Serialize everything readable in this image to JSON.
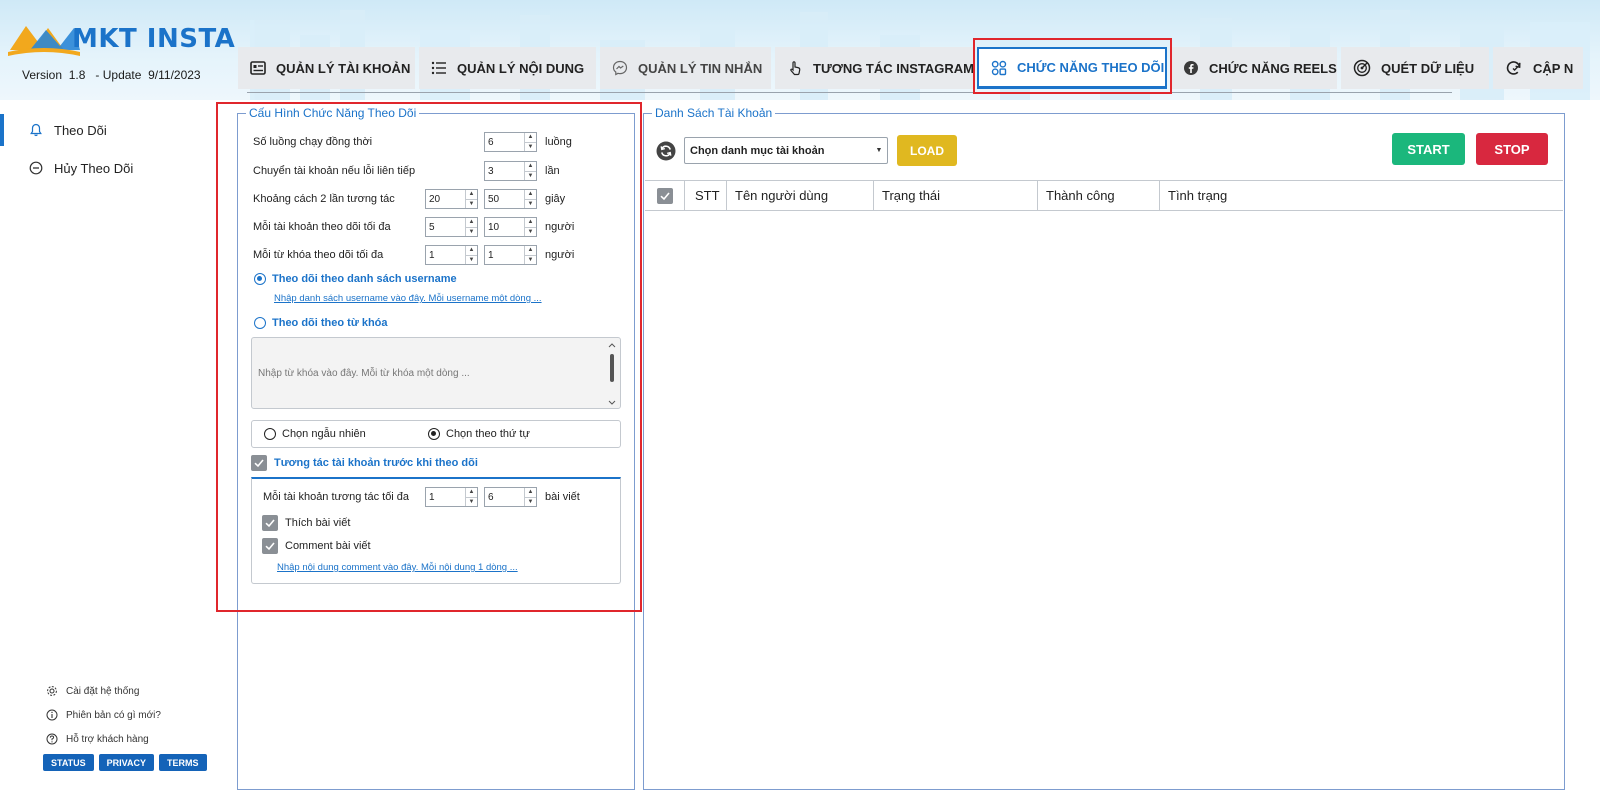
{
  "app": {
    "name": "MKT INSTA",
    "version_label": "Version",
    "version": "1.8",
    "update_label": "- Update",
    "update_date": "9/11/2023"
  },
  "tabs": [
    {
      "label": "QUẢN LÝ TÀI KHOẢN",
      "icon": "account-list-icon"
    },
    {
      "label": "QUẢN LÝ NỘI DUNG",
      "icon": "content-list-icon"
    },
    {
      "label": "QUẢN LÝ TIN NHẮN",
      "icon": "messenger-icon"
    },
    {
      "label": "TƯƠNG TÁC INSTAGRAM",
      "icon": "hand-tap-icon"
    },
    {
      "label": "CHỨC NĂNG THEO DÕI",
      "icon": "follow-grid-icon",
      "active": true
    },
    {
      "label": "CHỨC NĂNG REELS",
      "icon": "facebook-icon"
    },
    {
      "label": "QUÉT DỮ LIỆU",
      "icon": "radar-icon"
    },
    {
      "label": "CẬP N",
      "icon": "refresh-check-icon"
    }
  ],
  "sidebar": {
    "items": [
      {
        "label": "Theo Dõi",
        "icon": "bell-icon",
        "active": true
      },
      {
        "label": "Hủy Theo Dõi",
        "icon": "minus-circle-icon"
      }
    ],
    "footer_links": [
      {
        "label": "Cài đặt hệ thống",
        "icon": "gear-icon"
      },
      {
        "label": "Phiên bản có gì mới?",
        "icon": "info-icon"
      },
      {
        "label": "Hỗ trợ khách hàng",
        "icon": "help-icon"
      }
    ],
    "badges": [
      "STATUS",
      "PRIVACY",
      "TERMS"
    ]
  },
  "config": {
    "title": "Cấu Hình Chức Năng Theo Dõi",
    "threads_label": "Số luồng chạy đồng thời",
    "threads_value": "6",
    "threads_unit": "luồng",
    "switch_label": "Chuyển tài khoản nếu lỗi liên tiếp",
    "switch_value": "3",
    "switch_unit": "lần",
    "delay_label": "Khoảng cách 2 lần tương tác",
    "delay_min": "20",
    "delay_max": "50",
    "delay_unit": "giây",
    "per_account_label": "Mỗi tài khoản theo dõi tối đa",
    "per_account_min": "5",
    "per_account_max": "10",
    "per_account_unit": "người",
    "per_keyword_label": "Mỗi từ khóa theo dõi tối đa",
    "per_keyword_min": "1",
    "per_keyword_max": "1",
    "per_keyword_unit": "người",
    "mode_username_label": "Theo dõi theo danh sách username",
    "mode_username_link": "Nhập danh sách username vào đây. Mỗi username một dòng ...",
    "mode_keyword_label": "Theo dõi theo từ khóa",
    "keyword_placeholder": "Nhập từ khóa vào đây. Mỗi từ khóa một dòng ...",
    "order_random_label": "Chọn ngẫu nhiên",
    "order_sequence_label": "Chọn theo thứ tự",
    "interact_label": "Tương tác tài khoản trước khi theo dõi",
    "interact_max_label": "Mỗi tài khoản tương tác tối đa",
    "interact_min": "1",
    "interact_max": "6",
    "interact_unit": "bài viết",
    "like_label": "Thích bài viết",
    "comment_label": "Comment bài viết",
    "comment_link": "Nhập nội dung comment vào đây. Mỗi nội dung 1 dòng ..."
  },
  "accounts": {
    "title": "Danh Sách Tài Khoản",
    "category_select": "Chọn danh mục tài khoản",
    "load_button": "LOAD",
    "start_button": "START",
    "stop_button": "STOP",
    "columns": [
      "STT",
      "Tên người dùng",
      "Trạng thái",
      "Thành công",
      "Tình trạng"
    ]
  },
  "colors": {
    "accent": "#1b73c9",
    "start": "#1bb77c",
    "stop": "#d8283f",
    "load": "#e0b820",
    "highlight": "#e0262c"
  }
}
